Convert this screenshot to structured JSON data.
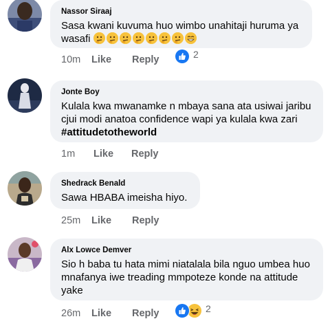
{
  "comments": [
    {
      "author": "Nassor Siraaj",
      "text": "Sasa kwani kuvuma huo wimbo unahitaji huruma ya wasafi",
      "emojis": [
        "thinking-face-emoji",
        "thinking-face-emoji",
        "thinking-face-emoji",
        "thinking-face-emoji",
        "thinking-face-emoji",
        "thinking-face-emoji",
        "thinking-face-emoji",
        "grinning-face-emoji"
      ],
      "time": "10m",
      "like_label": "Like",
      "reply_label": "Reply",
      "reaction_icons": [
        "like-reaction-icon"
      ],
      "reaction_count": "2"
    },
    {
      "author": "Jonte Boy",
      "text": "Kulala kwa mwanamke n mbaya sana ata usiwai jaribu cjui modi anatoa confidence wapi ya kulala kwa zari",
      "hashtag": "#attitudetotheworld",
      "time": "1m",
      "like_label": "Like",
      "reply_label": "Reply"
    },
    {
      "author": "Shedrack Benald",
      "text": "Sawa HBABA imeisha hiyo.",
      "time": "25m",
      "like_label": "Like",
      "reply_label": "Reply"
    },
    {
      "author": "Alx Lowce Demver",
      "text": "Sio h baba tu hata mimi niatalala bila nguo umbea huo mnafanya iwe treading  mmpoteze konde na attitude yake",
      "time": "26m",
      "like_label": "Like",
      "reply_label": "Reply",
      "reaction_icons": [
        "like-reaction-icon",
        "haha-reaction-icon"
      ],
      "reaction_count": "2"
    }
  ],
  "colors": {
    "bubble": "#f0f2f5",
    "meta_text": "#65676b",
    "like_blue": "#1877f2",
    "emoji_yellow": "#f7c23c"
  }
}
